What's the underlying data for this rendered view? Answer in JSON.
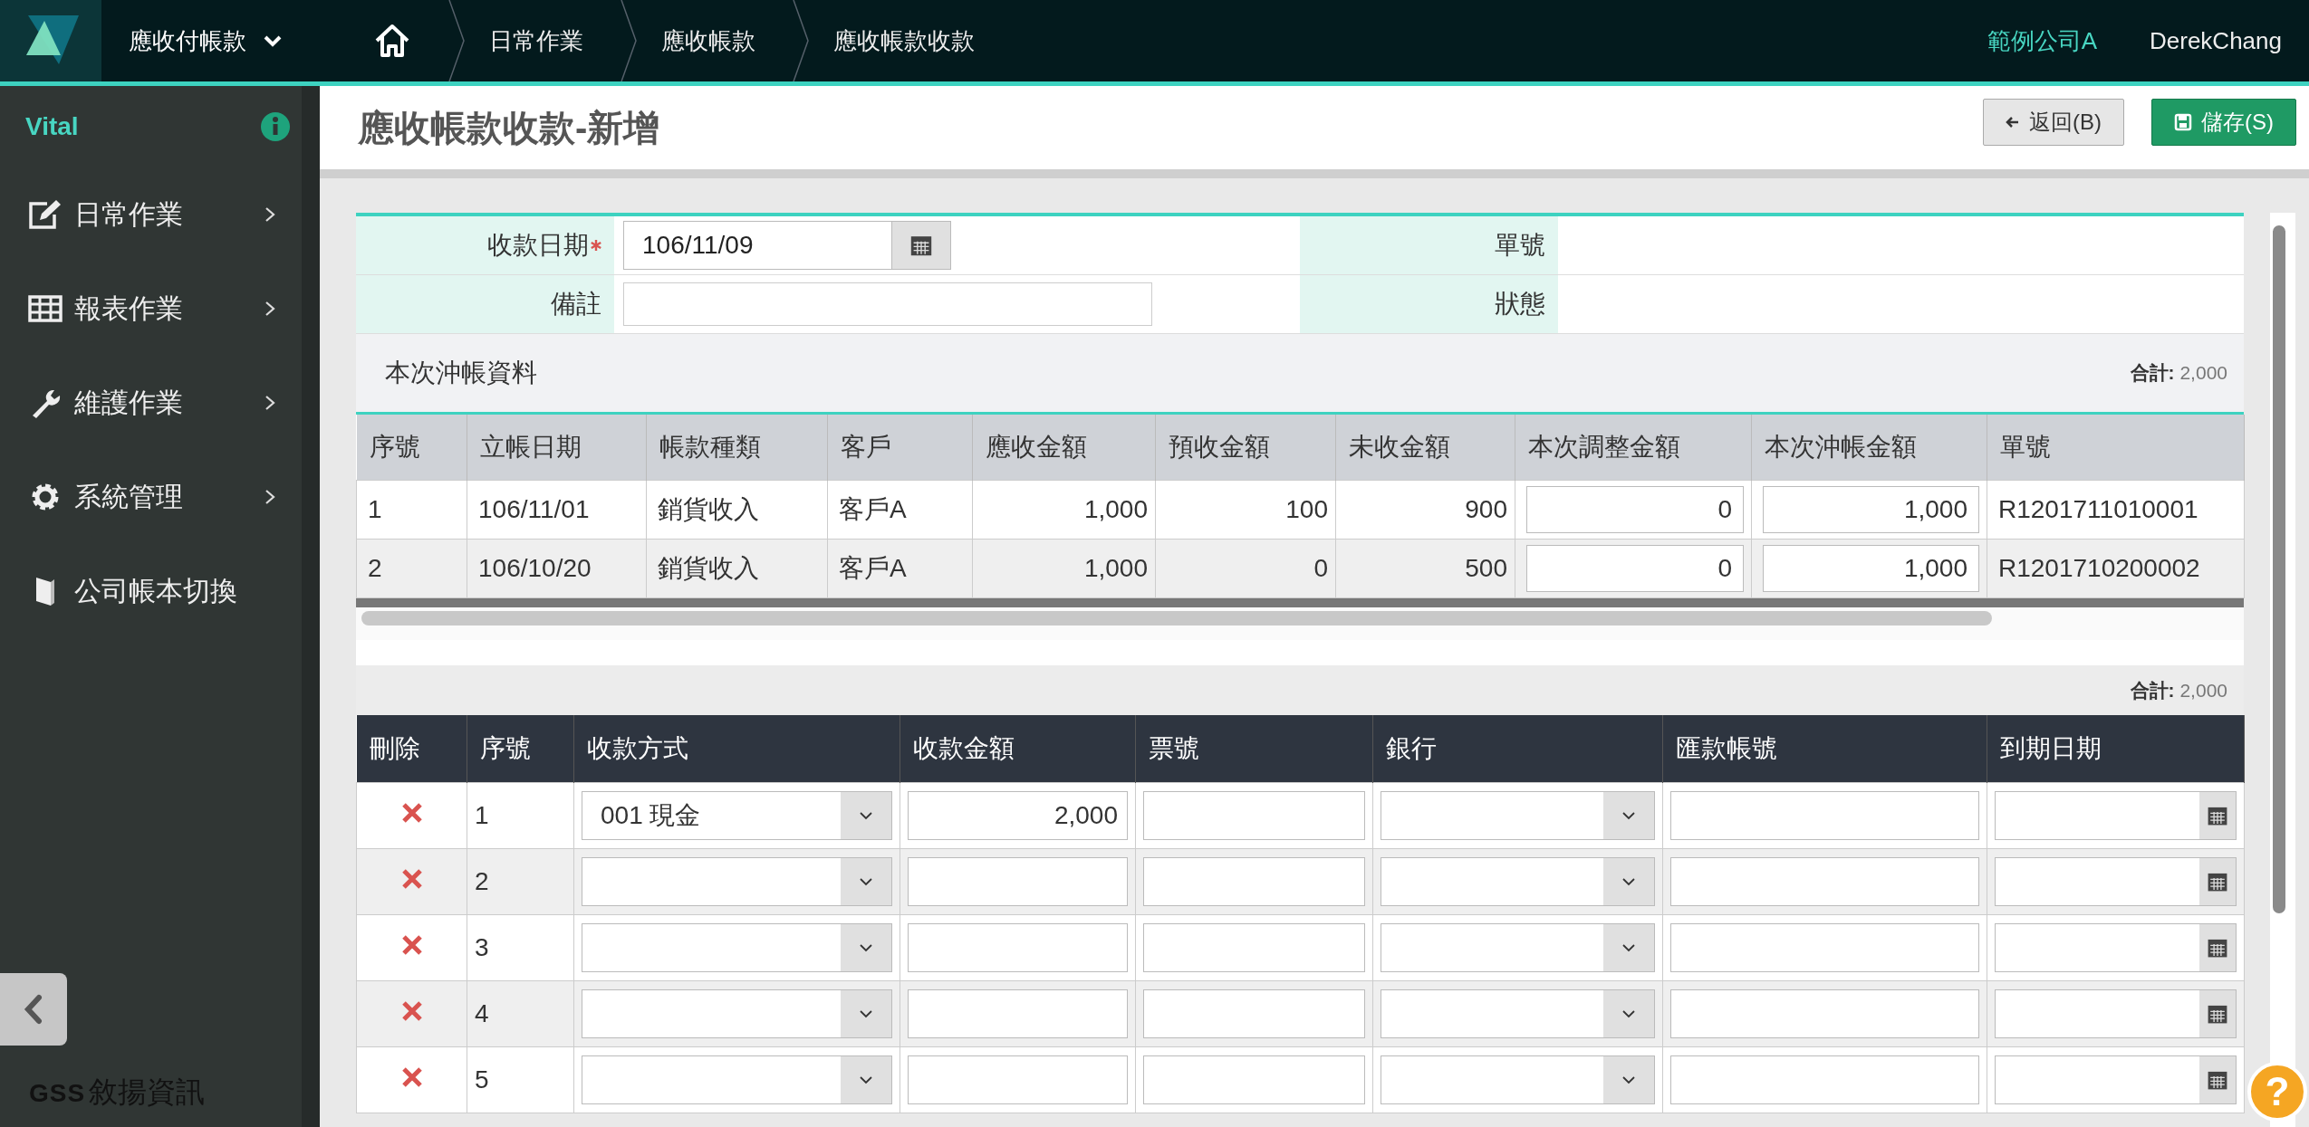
{
  "top_bar": {
    "module": "應收付帳款",
    "breadcrumbs": [
      "日常作業",
      "應收帳款",
      "應收帳款收款"
    ],
    "company": "範例公司A",
    "user": "DerekChang"
  },
  "sidebar": {
    "title": "Vital",
    "items": [
      {
        "label": "日常作業",
        "kind": "edit",
        "has_submenu": true
      },
      {
        "label": "報表作業",
        "kind": "table",
        "has_submenu": true
      },
      {
        "label": "維護作業",
        "kind": "wrench",
        "has_submenu": true
      },
      {
        "label": "系統管理",
        "kind": "gear",
        "has_submenu": true
      },
      {
        "label": "公司帳本切換",
        "kind": "book",
        "has_submenu": false
      }
    ],
    "brand": {
      "mark": "GSS",
      "name": "敘揚資訊"
    }
  },
  "page": {
    "title": "應收帳款收款-新增",
    "buttons": [
      {
        "label": "返回(B)",
        "kind": "back"
      },
      {
        "label": "儲存(S)",
        "kind": "save"
      }
    ]
  },
  "form": {
    "rows": [
      [
        {
          "label": "收款日期",
          "required": true,
          "kind": "date",
          "value": "106/11/09"
        },
        {
          "label": "單號",
          "required": false,
          "kind": "readonly"
        }
      ],
      [
        {
          "label": "備註",
          "required": false,
          "kind": "text"
        },
        {
          "label": "狀態",
          "required": false,
          "kind": "readonly"
        }
      ]
    ]
  },
  "settlement": {
    "title": "本次沖帳資料",
    "total_label": "合計:",
    "total": "2,000",
    "columns": [
      {
        "label": "序號",
        "kind": "text"
      },
      {
        "label": "立帳日期",
        "kind": "text"
      },
      {
        "label": "帳款種類",
        "kind": "text"
      },
      {
        "label": "客戶",
        "kind": "text"
      },
      {
        "label": "應收金額",
        "kind": "number"
      },
      {
        "label": "預收金額",
        "kind": "number"
      },
      {
        "label": "未收金額",
        "kind": "number"
      },
      {
        "label": "本次調整金額",
        "kind": "input"
      },
      {
        "label": "本次沖帳金額",
        "kind": "input"
      },
      {
        "label": "單號",
        "kind": "text"
      }
    ],
    "rows": [
      [
        "1",
        "106/11/01",
        "銷貨收入",
        "客戶A",
        "1,000",
        "100",
        "900",
        "0",
        "1,000",
        "R1201711010001"
      ],
      [
        "2",
        "106/10/20",
        "銷貨收入",
        "客戶A",
        "1,000",
        "0",
        "500",
        "0",
        "1,000",
        "R1201710200002"
      ]
    ]
  },
  "payments": {
    "total_label": "合計:",
    "total": "2,000",
    "columns": [
      "刪除",
      "序號",
      "收款方式",
      "收款金額",
      "票號",
      "銀行",
      "匯款帳號",
      "到期日期"
    ],
    "rows": [
      {
        "no": "1",
        "method": "001 現金",
        "amount": "2,000"
      },
      {
        "no": "2"
      },
      {
        "no": "3"
      },
      {
        "no": "4"
      },
      {
        "no": "5"
      }
    ]
  },
  "help": "?"
}
